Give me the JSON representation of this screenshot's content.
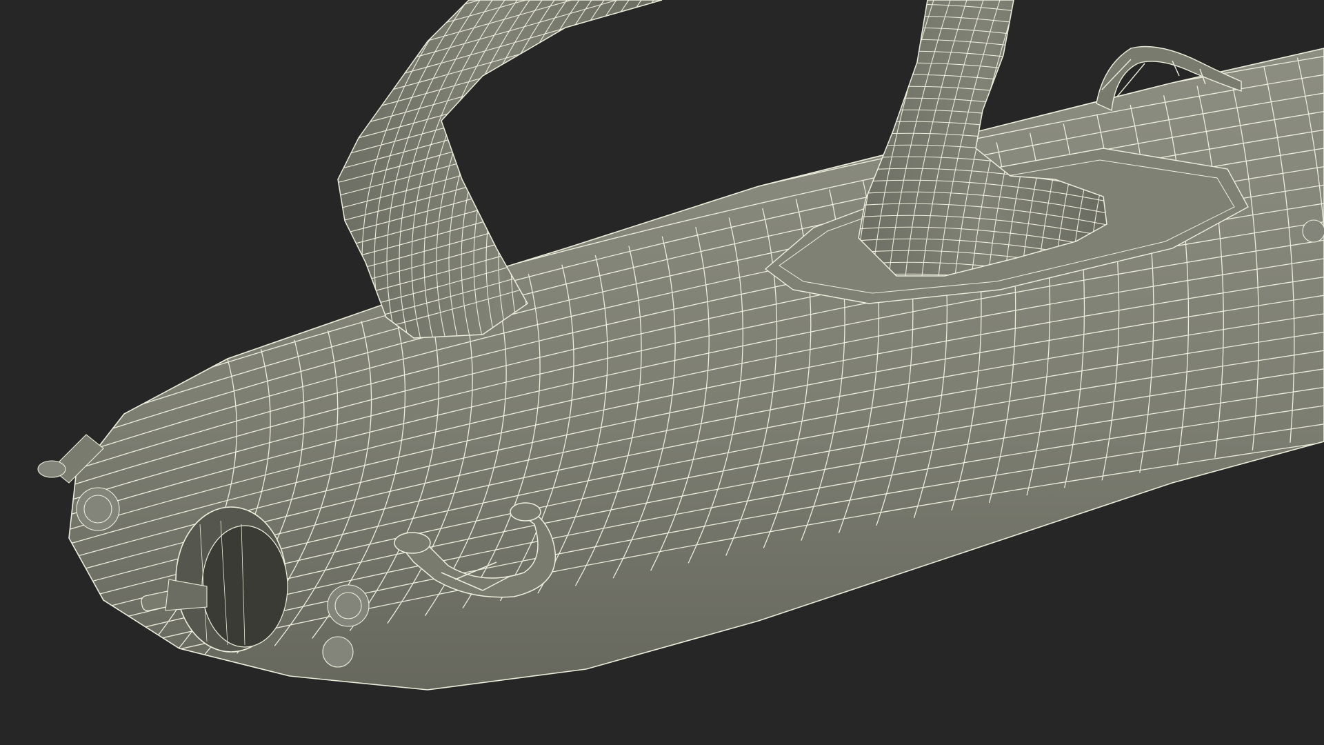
{
  "scene": {
    "subject": "wireframe-3d-model",
    "background_color": "#262626",
    "surface_color": "#7e7f73",
    "surface_shadow_color": "#6a6b60",
    "surface_light_color": "#8d8e82",
    "wire_color": "#eeeedd",
    "dark_opening_color": "#3a3b35"
  }
}
